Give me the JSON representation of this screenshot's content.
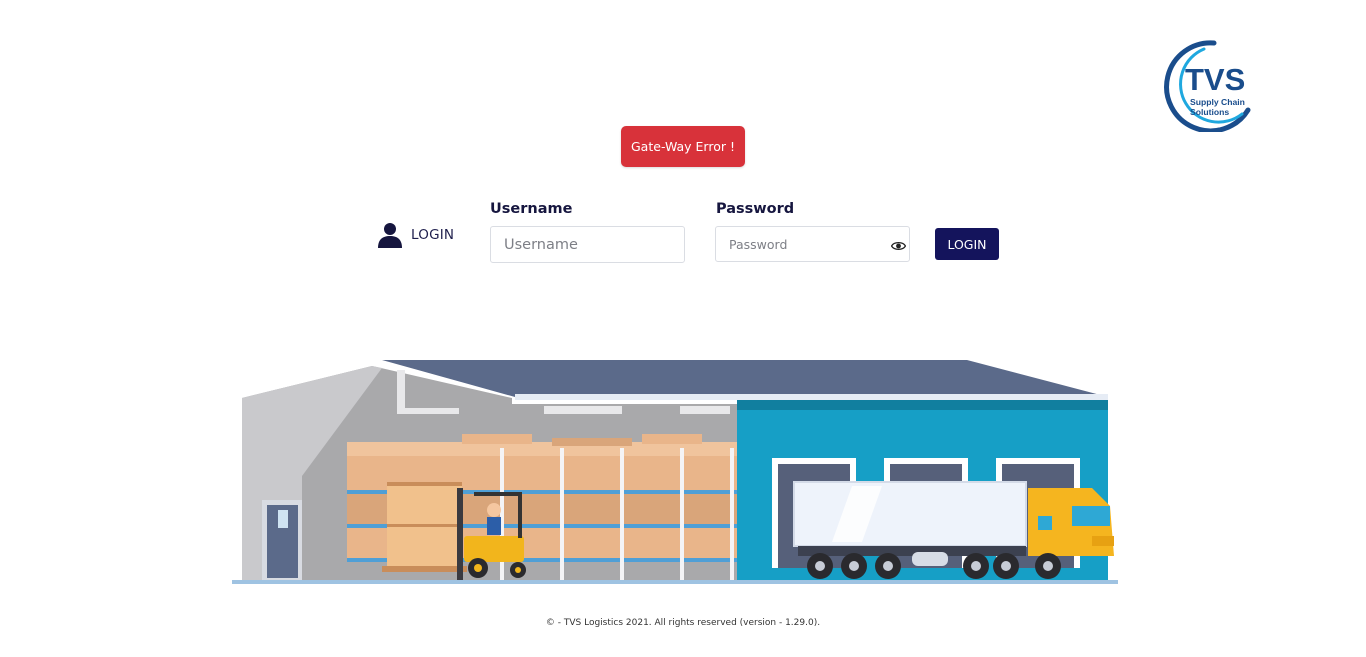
{
  "brand": {
    "logo_text": "TVS",
    "logo_subtext_line1": "Supply Chain",
    "logo_subtext_line2": "Solutions",
    "colors": {
      "primary": "#1a4d8c",
      "accent": "#1fa8df"
    }
  },
  "alert": {
    "text": "Gate-Way Error !",
    "color": "#d8323a"
  },
  "login_form": {
    "section_label": "LOGIN",
    "section_icon": "user-icon",
    "username": {
      "label": "Username",
      "placeholder": "Username",
      "value": ""
    },
    "password": {
      "label": "Password",
      "placeholder": "Password",
      "value": "",
      "toggle_icon": "eye-icon"
    },
    "submit_label": "LOGIN",
    "submit_color": "#14145c"
  },
  "footer": {
    "text": "© - TVS Logistics 2021. All rights reserved (version - 1.29.0)."
  }
}
